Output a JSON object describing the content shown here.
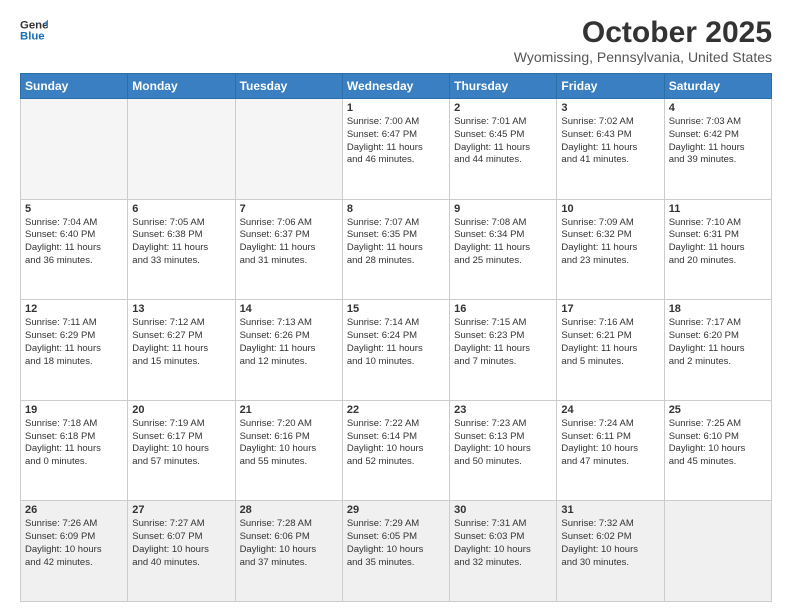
{
  "header": {
    "logo_line1": "General",
    "logo_line2": "Blue",
    "title": "October 2025",
    "subtitle": "Wyomissing, Pennsylvania, United States"
  },
  "days_of_week": [
    "Sunday",
    "Monday",
    "Tuesday",
    "Wednesday",
    "Thursday",
    "Friday",
    "Saturday"
  ],
  "weeks": [
    [
      {
        "num": "",
        "info": ""
      },
      {
        "num": "",
        "info": ""
      },
      {
        "num": "",
        "info": ""
      },
      {
        "num": "1",
        "info": "Sunrise: 7:00 AM\nSunset: 6:47 PM\nDaylight: 11 hours\nand 46 minutes."
      },
      {
        "num": "2",
        "info": "Sunrise: 7:01 AM\nSunset: 6:45 PM\nDaylight: 11 hours\nand 44 minutes."
      },
      {
        "num": "3",
        "info": "Sunrise: 7:02 AM\nSunset: 6:43 PM\nDaylight: 11 hours\nand 41 minutes."
      },
      {
        "num": "4",
        "info": "Sunrise: 7:03 AM\nSunset: 6:42 PM\nDaylight: 11 hours\nand 39 minutes."
      }
    ],
    [
      {
        "num": "5",
        "info": "Sunrise: 7:04 AM\nSunset: 6:40 PM\nDaylight: 11 hours\nand 36 minutes."
      },
      {
        "num": "6",
        "info": "Sunrise: 7:05 AM\nSunset: 6:38 PM\nDaylight: 11 hours\nand 33 minutes."
      },
      {
        "num": "7",
        "info": "Sunrise: 7:06 AM\nSunset: 6:37 PM\nDaylight: 11 hours\nand 31 minutes."
      },
      {
        "num": "8",
        "info": "Sunrise: 7:07 AM\nSunset: 6:35 PM\nDaylight: 11 hours\nand 28 minutes."
      },
      {
        "num": "9",
        "info": "Sunrise: 7:08 AM\nSunset: 6:34 PM\nDaylight: 11 hours\nand 25 minutes."
      },
      {
        "num": "10",
        "info": "Sunrise: 7:09 AM\nSunset: 6:32 PM\nDaylight: 11 hours\nand 23 minutes."
      },
      {
        "num": "11",
        "info": "Sunrise: 7:10 AM\nSunset: 6:31 PM\nDaylight: 11 hours\nand 20 minutes."
      }
    ],
    [
      {
        "num": "12",
        "info": "Sunrise: 7:11 AM\nSunset: 6:29 PM\nDaylight: 11 hours\nand 18 minutes."
      },
      {
        "num": "13",
        "info": "Sunrise: 7:12 AM\nSunset: 6:27 PM\nDaylight: 11 hours\nand 15 minutes."
      },
      {
        "num": "14",
        "info": "Sunrise: 7:13 AM\nSunset: 6:26 PM\nDaylight: 11 hours\nand 12 minutes."
      },
      {
        "num": "15",
        "info": "Sunrise: 7:14 AM\nSunset: 6:24 PM\nDaylight: 11 hours\nand 10 minutes."
      },
      {
        "num": "16",
        "info": "Sunrise: 7:15 AM\nSunset: 6:23 PM\nDaylight: 11 hours\nand 7 minutes."
      },
      {
        "num": "17",
        "info": "Sunrise: 7:16 AM\nSunset: 6:21 PM\nDaylight: 11 hours\nand 5 minutes."
      },
      {
        "num": "18",
        "info": "Sunrise: 7:17 AM\nSunset: 6:20 PM\nDaylight: 11 hours\nand 2 minutes."
      }
    ],
    [
      {
        "num": "19",
        "info": "Sunrise: 7:18 AM\nSunset: 6:18 PM\nDaylight: 11 hours\nand 0 minutes."
      },
      {
        "num": "20",
        "info": "Sunrise: 7:19 AM\nSunset: 6:17 PM\nDaylight: 10 hours\nand 57 minutes."
      },
      {
        "num": "21",
        "info": "Sunrise: 7:20 AM\nSunset: 6:16 PM\nDaylight: 10 hours\nand 55 minutes."
      },
      {
        "num": "22",
        "info": "Sunrise: 7:22 AM\nSunset: 6:14 PM\nDaylight: 10 hours\nand 52 minutes."
      },
      {
        "num": "23",
        "info": "Sunrise: 7:23 AM\nSunset: 6:13 PM\nDaylight: 10 hours\nand 50 minutes."
      },
      {
        "num": "24",
        "info": "Sunrise: 7:24 AM\nSunset: 6:11 PM\nDaylight: 10 hours\nand 47 minutes."
      },
      {
        "num": "25",
        "info": "Sunrise: 7:25 AM\nSunset: 6:10 PM\nDaylight: 10 hours\nand 45 minutes."
      }
    ],
    [
      {
        "num": "26",
        "info": "Sunrise: 7:26 AM\nSunset: 6:09 PM\nDaylight: 10 hours\nand 42 minutes."
      },
      {
        "num": "27",
        "info": "Sunrise: 7:27 AM\nSunset: 6:07 PM\nDaylight: 10 hours\nand 40 minutes."
      },
      {
        "num": "28",
        "info": "Sunrise: 7:28 AM\nSunset: 6:06 PM\nDaylight: 10 hours\nand 37 minutes."
      },
      {
        "num": "29",
        "info": "Sunrise: 7:29 AM\nSunset: 6:05 PM\nDaylight: 10 hours\nand 35 minutes."
      },
      {
        "num": "30",
        "info": "Sunrise: 7:31 AM\nSunset: 6:03 PM\nDaylight: 10 hours\nand 32 minutes."
      },
      {
        "num": "31",
        "info": "Sunrise: 7:32 AM\nSunset: 6:02 PM\nDaylight: 10 hours\nand 30 minutes."
      },
      {
        "num": "",
        "info": ""
      }
    ]
  ]
}
